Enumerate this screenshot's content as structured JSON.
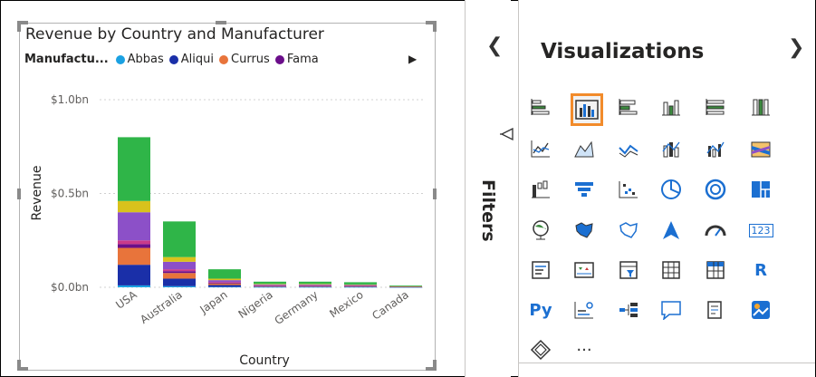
{
  "filters": {
    "label": "Filters",
    "collapse_icon": "chevron-left-icon",
    "filter_icon": "filter-icon"
  },
  "visualizations": {
    "title": "Visualizations",
    "expand_icon": "chevron-right-icon",
    "selected_icon": "clustered-column-chart-icon",
    "icons": [
      "stacked-bar-chart-icon",
      "clustered-column-chart-icon",
      "clustered-bar-chart-icon",
      "stacked-column-chart-icon",
      "100-stacked-bar-chart-icon",
      "100-stacked-column-chart-icon",
      "line-chart-icon",
      "area-chart-icon",
      "stacked-area-chart-icon",
      "line-and-column-chart-icon",
      "line-and-clustered-column-chart-icon",
      "ribbon-chart-icon",
      "waterfall-chart-icon",
      "funnel-chart-icon",
      "scatter-chart-icon",
      "pie-chart-icon",
      "donut-chart-icon",
      "treemap-icon",
      "map-icon",
      "filled-map-icon",
      "shape-map-icon",
      "azure-map-icon",
      "gauge-icon",
      "card-icon",
      "multi-row-card-icon",
      "kpi-icon",
      "slicer-icon",
      "table-icon",
      "matrix-icon",
      "r-visual-icon",
      "python-visual-icon",
      "key-influencers-icon",
      "decomposition-tree-icon",
      "qa-icon",
      "smart-narrative-icon",
      "arcgis-map-icon",
      "power-apps-icon",
      "more-visuals-icon"
    ],
    "text_glyphs": {
      "card": "123",
      "r": "R",
      "py": "Py",
      "more": "···"
    }
  },
  "chart_data": {
    "type": "bar",
    "title": "Revenue by Country and Manufacturer",
    "xlabel": "Country",
    "ylabel": "Revenue",
    "legend": {
      "title": "Manufactu...",
      "entries": [
        {
          "name": "Abbas",
          "color": "#1ba1e2"
        },
        {
          "name": "Aliqui",
          "color": "#1a2fa8"
        },
        {
          "name": "Currus",
          "color": "#e8743b"
        },
        {
          "name": "Fama",
          "color": "#6b0e8a"
        }
      ],
      "more_icon": "triangle-right-icon",
      "placement": "top-left"
    },
    "yticks": [
      "$0.0bn",
      "$0.5bn",
      "$1.0bn"
    ],
    "ylim": [
      0,
      1.0
    ],
    "categories": [
      "USA",
      "Australia",
      "Japan",
      "Nigeria",
      "Germany",
      "Mexico",
      "Canada"
    ],
    "series": [
      {
        "name": "Abbas",
        "color": "#1ba1e2",
        "values": [
          0.01,
          0.006,
          0.002,
          0.001,
          0.001,
          0.001,
          0.0005
        ]
      },
      {
        "name": "Aliqui",
        "color": "#1a2fa8",
        "values": [
          0.11,
          0.04,
          0.01,
          0.003,
          0.003,
          0.003,
          0.001
        ]
      },
      {
        "name": "Currus",
        "color": "#e8743b",
        "values": [
          0.09,
          0.03,
          0.008,
          0.003,
          0.003,
          0.002,
          0.001
        ]
      },
      {
        "name": "Fama",
        "color": "#6b0e8a",
        "values": [
          0.02,
          0.01,
          0.004,
          0.002,
          0.002,
          0.002,
          0.0005
        ]
      },
      {
        "name": "",
        "color": "#c93a8a",
        "values": [
          0.02,
          0.01,
          0.004,
          0.002,
          0.002,
          0.002,
          0.0005
        ]
      },
      {
        "name": "",
        "color": "#8c50c8",
        "values": [
          0.15,
          0.04,
          0.01,
          0.004,
          0.004,
          0.003,
          0.001
        ]
      },
      {
        "name": "",
        "color": "#d9c21c",
        "values": [
          0.06,
          0.025,
          0.008,
          0.003,
          0.003,
          0.002,
          0.001
        ]
      },
      {
        "name": "",
        "color": "#2fb548",
        "values": [
          0.34,
          0.19,
          0.05,
          0.012,
          0.012,
          0.012,
          0.004
        ]
      }
    ]
  }
}
